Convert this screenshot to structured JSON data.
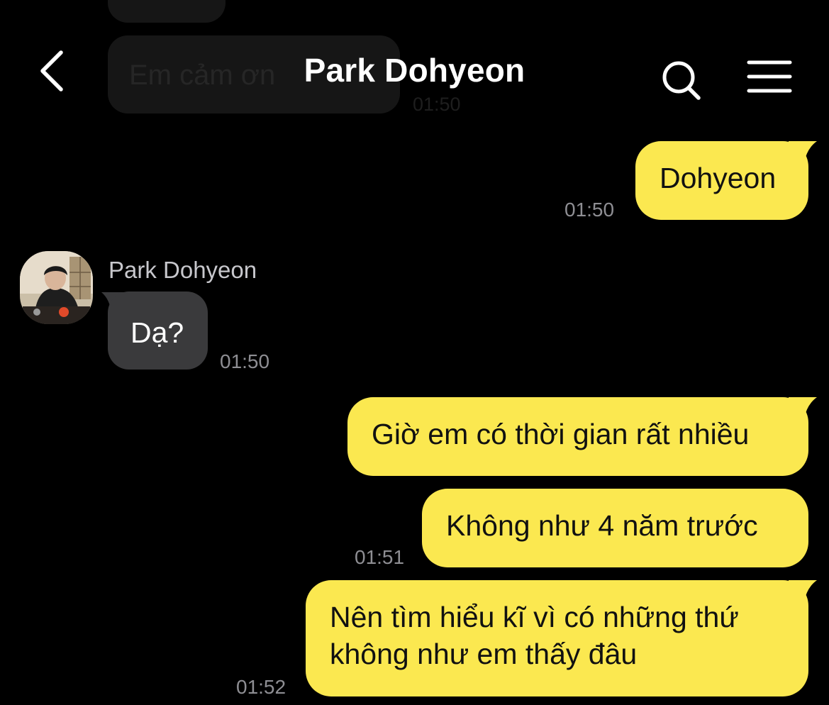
{
  "header": {
    "title": "Park Dohyeon",
    "back_icon": "chevron-left-icon",
    "search_icon": "search-icon",
    "menu_icon": "hamburger-menu-icon"
  },
  "partial_message": {
    "text": "Em cảm ơn",
    "time": "01:50"
  },
  "messages": [
    {
      "direction": "out",
      "lines": [
        "Dohyeon"
      ],
      "time": "01:50"
    },
    {
      "direction": "in",
      "sender": "Park Dohyeon",
      "lines": [
        "Dạ?"
      ],
      "time": "01:50"
    },
    {
      "direction": "out",
      "lines": [
        "Giờ em có thời gian rất nhiều"
      ],
      "time": ""
    },
    {
      "direction": "out",
      "lines": [
        "Không như 4 năm trước"
      ],
      "time": "01:51"
    },
    {
      "direction": "out",
      "lines": [
        "Nên tìm hiểu kĩ vì có những thứ",
        "không như em thấy đâu"
      ],
      "time": "01:52"
    }
  ],
  "colors": {
    "background": "#000000",
    "outgoing_bubble": "#fbe850",
    "incoming_bubble": "#3a3a3c",
    "timestamp": "#8e8e93"
  }
}
